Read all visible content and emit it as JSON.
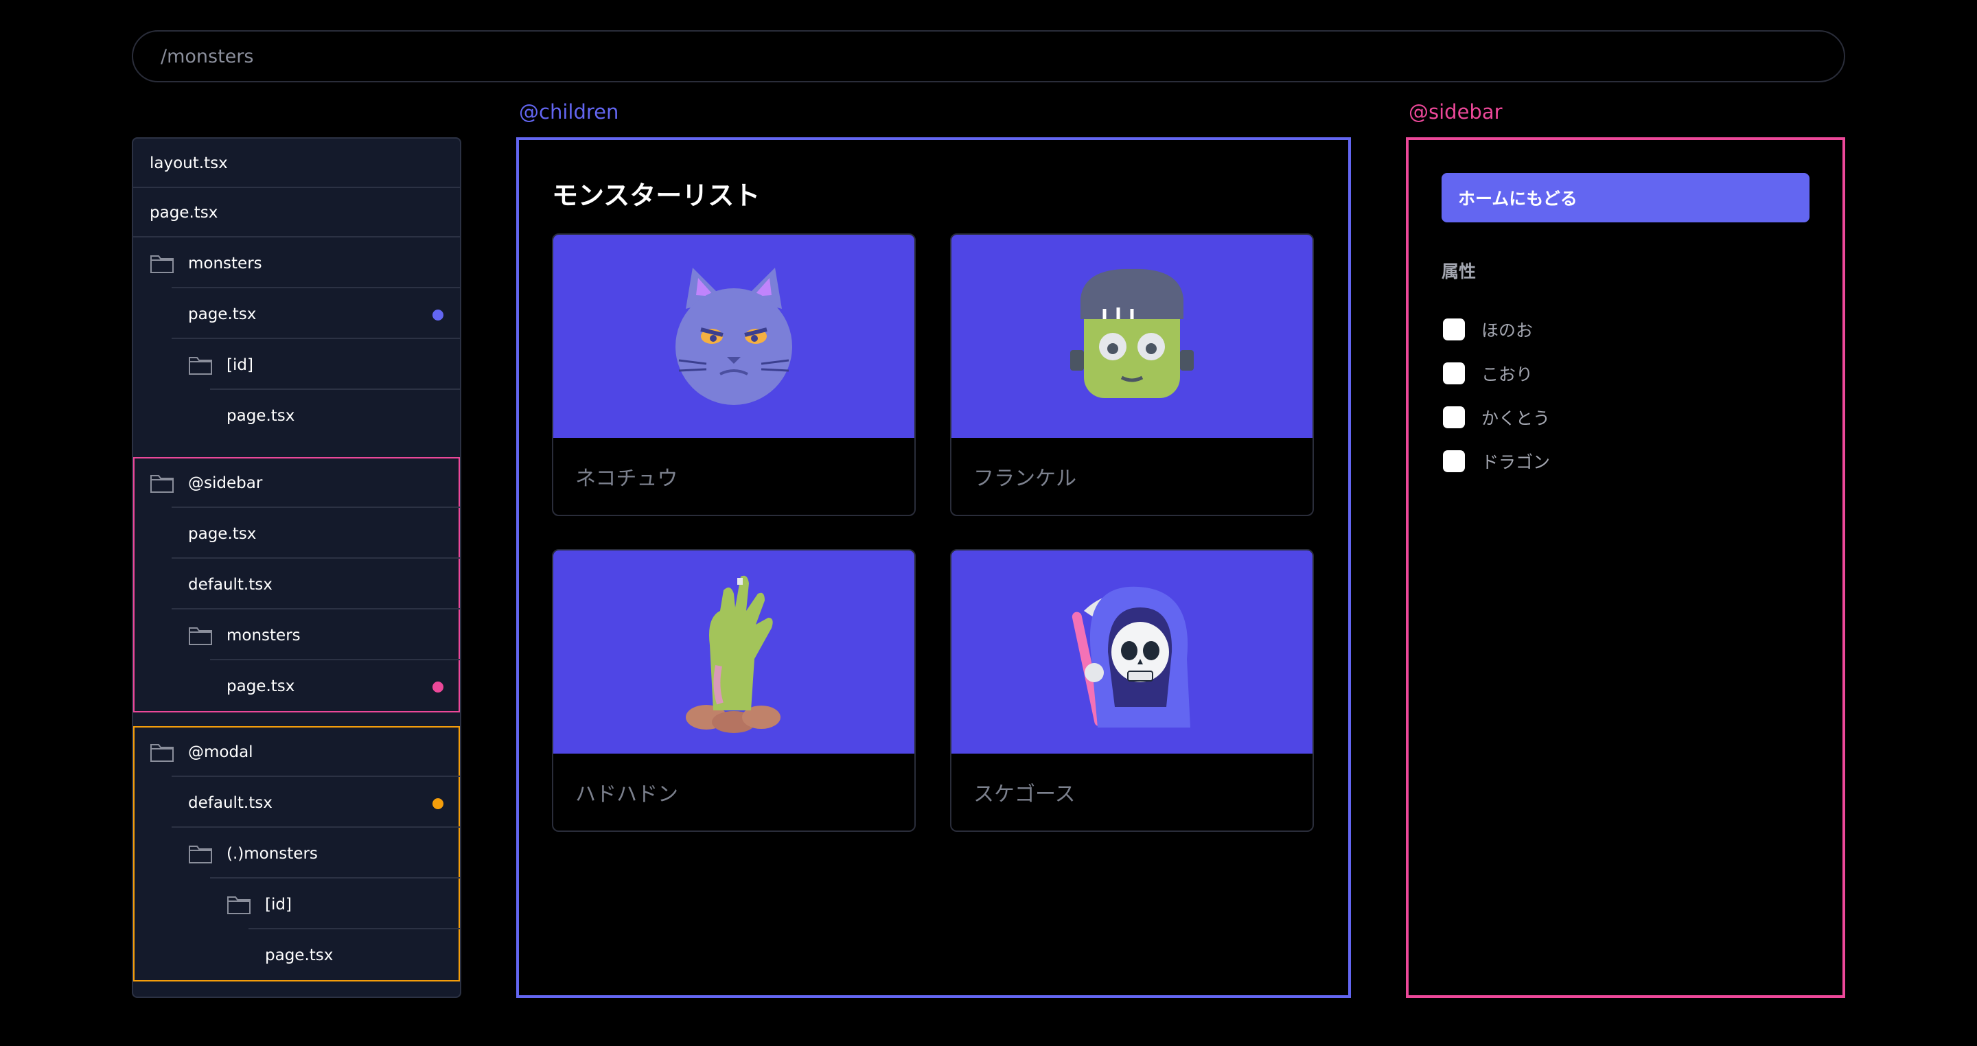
{
  "url_bar": {
    "path": "/monsters"
  },
  "tree": {
    "items": [
      {
        "label": "layout.tsx"
      },
      {
        "label": "page.tsx"
      },
      {
        "label": "monsters"
      },
      {
        "label": "page.tsx"
      },
      {
        "label": "[id]"
      },
      {
        "label": "page.tsx"
      },
      {
        "label": "@sidebar"
      },
      {
        "label": "page.tsx"
      },
      {
        "label": "default.tsx"
      },
      {
        "label": "monsters"
      },
      {
        "label": "page.tsx"
      },
      {
        "label": "@modal"
      },
      {
        "label": "default.tsx"
      },
      {
        "label": "(.)monsters"
      },
      {
        "label": "[id]"
      },
      {
        "label": "page.tsx"
      }
    ]
  },
  "children": {
    "slot_label": "@children",
    "title": "モンスターリスト",
    "cards": [
      {
        "name": "ネコチュウ",
        "icon": "cat-monster-icon"
      },
      {
        "name": "フランケル",
        "icon": "frankenstein-icon"
      },
      {
        "name": "ハドハドン",
        "icon": "zombie-hand-icon"
      },
      {
        "name": "スケゴース",
        "icon": "grim-reaper-icon"
      }
    ]
  },
  "sidebar": {
    "slot_label": "@sidebar",
    "home_button": "ホームにもどる",
    "attribute_label": "属性",
    "attributes": [
      "ほのお",
      "こおり",
      "かくとう",
      "ドラゴン"
    ]
  },
  "colors": {
    "children": "#6366f1",
    "sidebar": "#ec4899",
    "modal": "#f59e0b",
    "card_bg": "#4f46e5"
  }
}
